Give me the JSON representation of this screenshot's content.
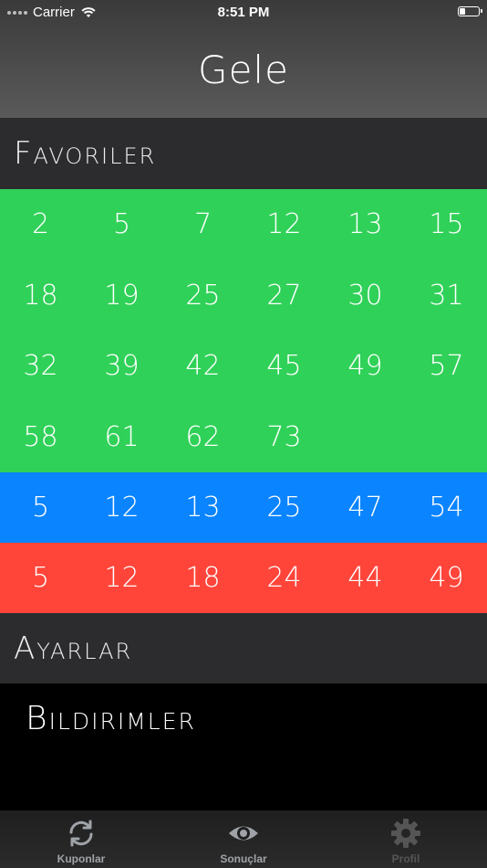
{
  "status_bar": {
    "carrier": "Carrier",
    "time": "8:51 PM"
  },
  "app": {
    "title": "Gele"
  },
  "favorites": {
    "header": "Favoriler",
    "green_rows": [
      [
        "2",
        "5",
        "7",
        "12",
        "13",
        "15"
      ],
      [
        "18",
        "19",
        "25",
        "27",
        "30",
        "31"
      ],
      [
        "32",
        "39",
        "42",
        "45",
        "49",
        "57"
      ],
      [
        "58",
        "61",
        "62",
        "73",
        "",
        ""
      ]
    ],
    "blue_row": [
      "5",
      "12",
      "13",
      "25",
      "47",
      "54"
    ],
    "red_row": [
      "5",
      "12",
      "18",
      "24",
      "44",
      "49"
    ],
    "colors": {
      "green": "#30d158",
      "blue": "#0a84ff",
      "red": "#ff453a"
    }
  },
  "settings": {
    "header": "Ayarlar",
    "notifications_label": "Bildirimler"
  },
  "tab_bar": {
    "tabs": [
      {
        "label": "Kuponlar",
        "icon": "refresh-icon",
        "color": "#9fa3a8"
      },
      {
        "label": "Sonuçlar",
        "icon": "eye-icon",
        "color": "#9fa3a8"
      },
      {
        "label": "Profil",
        "icon": "gear-icon",
        "color": "#555555"
      }
    ]
  }
}
